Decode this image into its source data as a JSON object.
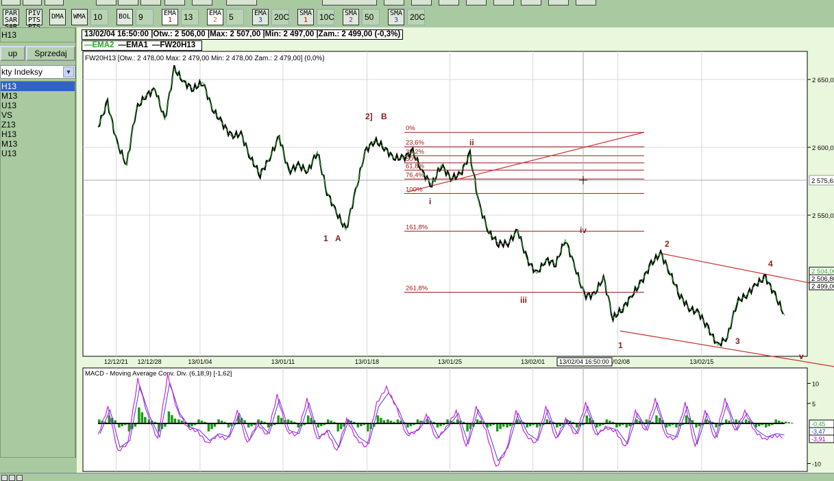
{
  "toolbar": {
    "buttons": [
      {
        "label": "PAR SAR"
      },
      {
        "label": "PIV PTS"
      },
      {
        "label": "DMA"
      },
      {
        "label": "WMA",
        "value": "10"
      },
      {
        "label": "BOL",
        "value": "9"
      },
      {
        "label": "EMA",
        "idx": "1",
        "value": "13",
        "color": "#d00000"
      },
      {
        "label": "EMA",
        "idx": "2",
        "value": "5",
        "color": "#d07000"
      },
      {
        "label": "EMA",
        "idx": "3",
        "value": "20C",
        "color": "#2040c0"
      },
      {
        "label": "SMA",
        "idx": "1",
        "value": "10C",
        "color": "#d00000"
      },
      {
        "label": "SMA",
        "idx": "2",
        "value": "50",
        "color": "#a020a0"
      },
      {
        "label": "SMA",
        "idx": "3",
        "value": "20C",
        "color": "#2040c0"
      }
    ]
  },
  "left": {
    "title": "H13",
    "buy_label": "up",
    "sell_label": "Sprzedaj",
    "dropdown": "kty Indeksy",
    "items": [
      "H13",
      "M13",
      "U13",
      "VS",
      "Z13",
      "H13",
      "M13",
      "U13"
    ]
  },
  "info": {
    "bar": "13/02/04 16:50:00 |Otw.: 2 506,00 |Max: 2 507,00 |Min: 2 497,00 |Zam.: 2 499,00 (-0,3%)",
    "legend": [
      {
        "label": "EMA2",
        "color": "#22aa22"
      },
      {
        "label": "EMA1",
        "color": "#000000"
      },
      {
        "label": "FW20H13",
        "color": "#000000"
      }
    ],
    "header": "FW20H13 [Otw.: 2 478,00  Max: 2 479,00  Min: 2 478,00  Zam.: 2 479,00] (0,0%)"
  },
  "chart_data": [
    {
      "type": "line",
      "title": "FW20H13",
      "ylim": [
        2440,
        2670
      ],
      "yticks": [
        2650,
        2600,
        2550
      ],
      "ytick_labels": [
        "2 650,00",
        "2 600,00",
        "2 550,00"
      ],
      "xtick_labels": [
        "12/12/21",
        "12/12/28",
        "13/01/04",
        "13/01/11",
        "13/01/18",
        "13/01/25",
        "13/02/01",
        "13/02/08",
        "13/02/15"
      ],
      "xtick_pos": [
        1.9,
        5.4,
        10.7,
        19.4,
        28.2,
        36.9,
        45.6,
        54.5,
        63.3
      ],
      "price": [
        2615,
        2633,
        2603,
        2587,
        2628,
        2638,
        2643,
        2620,
        2658,
        2648,
        2643,
        2648,
        2628,
        2618,
        2608,
        2610,
        2592,
        2580,
        2592,
        2608,
        2582,
        2587,
        2582,
        2597,
        2567,
        2552,
        2539,
        2567,
        2597,
        2605,
        2600,
        2592,
        2592,
        2597,
        2582,
        2572,
        2587,
        2577,
        2580,
        2595,
        2557,
        2537,
        2529,
        2529,
        2539,
        2517,
        2507,
        2517,
        2514,
        2532,
        2512,
        2491,
        2491,
        2504,
        2474,
        2481,
        2491,
        2501,
        2514,
        2522,
        2507,
        2491,
        2481,
        2478,
        2466,
        2454,
        2460,
        2486,
        2491,
        2499,
        2504,
        2491,
        2476
      ],
      "fib": {
        "high": 2611,
        "low": 2566,
        "levels": [
          {
            "r": 0,
            "label": "0%"
          },
          {
            "r": 0.236,
            "label": "23,6%"
          },
          {
            "r": 0.382,
            "label": "38,2%"
          },
          {
            "r": 0.5,
            "label": "50%"
          },
          {
            "r": 0.618,
            "label": "61,8%"
          },
          {
            "r": 0.764,
            "label": "76,4%"
          },
          {
            "r": 1,
            "label": "100%"
          },
          {
            "r": 1.618,
            "label": "161,8%"
          },
          {
            "r": 2.618,
            "label": "261,8%"
          }
        ]
      },
      "wave_labels": [
        "1",
        "A",
        "2]",
        "B",
        "i",
        "ii",
        "iii",
        "iv",
        "1",
        "2",
        "3",
        "4",
        "v"
      ],
      "crosshair": {
        "price_label": "2 575,63",
        "date_label": "13/02/04 16:50:00"
      },
      "value_boxes": [
        {
          "label": "2 504,00",
          "color": "#22aa22"
        },
        {
          "label": "2 506,80",
          "color": "#000"
        },
        {
          "label": "2 499,00",
          "color": "#000"
        }
      ]
    },
    {
      "type": "line",
      "title": "MACD - Moving Average Conv. Div. (6,18,9) [-1,62]",
      "ylim": [
        -11,
        12
      ],
      "yticks": [
        10,
        5,
        -10
      ],
      "ytick_labels": [
        "10",
        "5",
        "-10"
      ],
      "macd": [
        -3,
        4,
        -7,
        -5,
        11,
        2,
        -4,
        12,
        3,
        -1,
        -2,
        -5,
        -3,
        -4,
        3,
        -5,
        0,
        -3,
        7,
        -2,
        -3,
        6,
        -4,
        -2,
        -7,
        1,
        -4,
        -6,
        5,
        9,
        4,
        -3,
        -2,
        2,
        -4,
        -1,
        3,
        -6,
        4,
        -2,
        -11,
        -7,
        3,
        -3,
        -5,
        4,
        -4,
        1,
        -3,
        5,
        -3,
        -1,
        -2,
        -6,
        3,
        -2,
        6,
        -3,
        -4,
        5,
        -6,
        3,
        -4,
        6,
        -2,
        3,
        -2,
        -4,
        -3,
        -3.5
      ],
      "histogram": [
        1,
        2,
        -1,
        -2,
        4,
        1,
        -2,
        3,
        1,
        -1,
        1,
        -2,
        1,
        -1,
        2,
        -1,
        1,
        -1,
        2,
        1,
        -1,
        2,
        -1,
        1,
        -2,
        1,
        -1,
        -2,
        2,
        1,
        1,
        -1,
        1,
        1,
        -1,
        1,
        1,
        -2,
        1,
        -1,
        -2,
        -1,
        1,
        -1,
        -1,
        1,
        -1,
        1,
        -1,
        2,
        -1,
        1,
        -1,
        -1,
        1,
        1,
        2,
        -1,
        -1,
        2,
        -1,
        1,
        -1,
        1,
        1,
        1,
        -1,
        -1,
        1,
        0.45
      ],
      "value_boxes": [
        {
          "label": "-0,45",
          "color": "#22aa22"
        },
        {
          "label": "-3,47",
          "color": "#2040c0"
        },
        {
          "label": "-3,91",
          "color": "#a000c0"
        }
      ]
    }
  ]
}
